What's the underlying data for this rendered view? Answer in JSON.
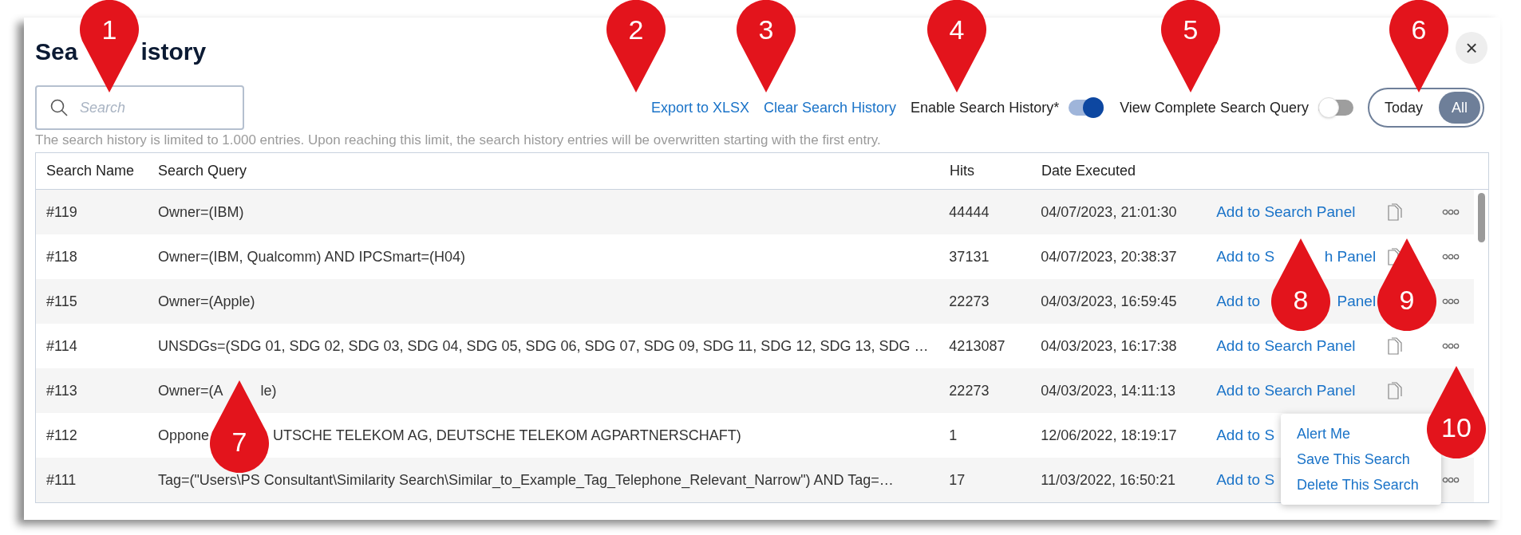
{
  "dialog": {
    "title": [
      "Sea",
      "istory"
    ],
    "close": "×"
  },
  "search": {
    "placeholder": "Search"
  },
  "toolbar": {
    "export": "Export to XLSX",
    "clear": "Clear Search History",
    "toggles": [
      {
        "label": "Enable Search History*",
        "on": true
      },
      {
        "label": "View Complete Search Query",
        "on": false
      }
    ],
    "range": [
      {
        "label": "Today",
        "selected": false
      },
      {
        "label": "All",
        "selected": true
      }
    ]
  },
  "note": "The search history is limited to 1.000 entries. Upon reaching this limit, the search history entries will be overwritten starting with the first entry.",
  "table": {
    "columns": [
      "Search Name",
      "Search Query",
      "Hits",
      "Date Executed"
    ],
    "rows": [
      {
        "name": "#119",
        "query": [
          "Owner=(IBM)"
        ],
        "hits": "44444",
        "date": "04/07/2023, 21:01:30",
        "action": [
          "Add to Search Panel"
        ],
        "copy_icon": true,
        "more_icon": true
      },
      {
        "name": "#118",
        "query": [
          "Owner=(IBM, Qualcomm) AND IPCSmart=(H04)"
        ],
        "hits": "37131",
        "date": "04/07/2023, 20:38:37",
        "action": [
          "Add to S",
          "h Panel"
        ],
        "copy_icon": true,
        "more_icon": true
      },
      {
        "name": "#115",
        "query": [
          "Owner=(Apple)"
        ],
        "hits": "22273",
        "date": "04/03/2023, 16:59:45",
        "action": [
          "Add to",
          "Panel"
        ],
        "copy_icon": false,
        "more_icon": true
      },
      {
        "name": "#114",
        "query": [
          "UNSDGs=(SDG 01, SDG 02, SDG 03, SDG 04, SDG 05, SDG 06, SDG 07, SDG 09, SDG 11, SDG 12, SDG 13, SDG …"
        ],
        "hits": "4213087",
        "date": "04/03/2023, 16:17:38",
        "action": [
          "Add to Search Panel"
        ],
        "copy_icon": true,
        "more_icon": true
      },
      {
        "name": "#113",
        "query": [
          "Owner=(A",
          "le)"
        ],
        "hits": "22273",
        "date": "04/03/2023, 14:11:13",
        "action": [
          "Add to Search Panel"
        ],
        "copy_icon": true,
        "more_icon": false
      },
      {
        "name": "#112",
        "query": [
          "Oppone",
          "UTSCHE TELEKOM AG, DEUTSCHE TELEKOM AGPARTNERSCHAFT)"
        ],
        "hits": "1",
        "date": "12/06/2022, 18:19:17",
        "action": [
          "Add to S"
        ],
        "copy_icon": false,
        "more_icon": false
      },
      {
        "name": "#111",
        "query": [
          "Tag=(\"Users\\PS Consultant\\Similarity Search\\Similar_to_Example_Tag_Telephone_Relevant_Narrow\") AND Tag=…"
        ],
        "hits": "17",
        "date": "11/03/2022, 16:50:21",
        "action": [
          "Add to S"
        ],
        "copy_icon": false,
        "more_icon": true
      }
    ]
  },
  "menu": {
    "items": [
      "Alert Me",
      "Save This Search",
      "Delete This Search"
    ]
  },
  "callouts": [
    {
      "number": "1",
      "kind": "down"
    },
    {
      "number": "2",
      "kind": "down"
    },
    {
      "number": "3",
      "kind": "down"
    },
    {
      "number": "4",
      "kind": "down"
    },
    {
      "number": "5",
      "kind": "down"
    },
    {
      "number": "6",
      "kind": "down"
    },
    {
      "number": "7",
      "kind": "up"
    },
    {
      "number": "8",
      "kind": "up"
    },
    {
      "number": "9",
      "kind": "up"
    },
    {
      "number": "10",
      "kind": "up"
    }
  ]
}
